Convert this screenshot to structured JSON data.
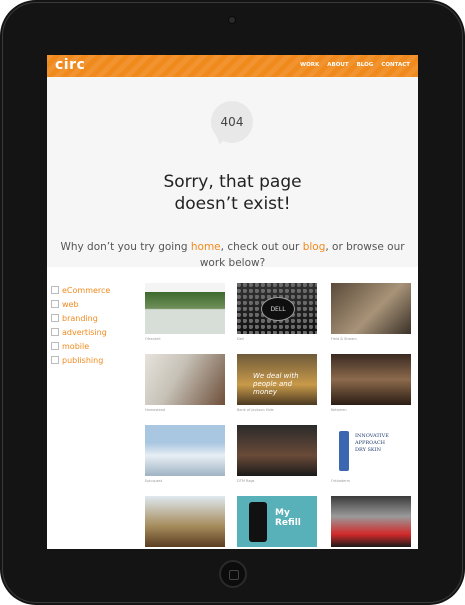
{
  "site": {
    "logo": "circ"
  },
  "nav": {
    "items": [
      "WORK",
      "ABOUT",
      "BLOG",
      "CONTACT"
    ]
  },
  "hero": {
    "badge": "404",
    "headline_line1": "Sorry, that page",
    "headline_line2": "doesn’t exist!",
    "sub_prefix": "Why don’t you try going",
    "sub_home": "home",
    "sub_mid": ", check out our",
    "sub_blog": "blog",
    "sub_suffix": ", or browse our work below?"
  },
  "filters": [
    "eCommerce",
    "web",
    "branding",
    "advertising",
    "mobile",
    "publishing"
  ],
  "portfolio": [
    {
      "caption": "Ofrackell"
    },
    {
      "caption": "Dell"
    },
    {
      "caption": "Field & Stream"
    },
    {
      "caption": "Homestead"
    },
    {
      "caption": "Bank of Jackson Hole"
    },
    {
      "caption": "Ketamen"
    },
    {
      "caption": "Epicquest"
    },
    {
      "caption": "DTM Rags"
    },
    {
      "caption": "Orthoderm"
    },
    {
      "caption": ""
    },
    {
      "caption": ""
    },
    {
      "caption": ""
    }
  ],
  "colors": {
    "accent": "#f08a1d",
    "device": "#141414"
  }
}
